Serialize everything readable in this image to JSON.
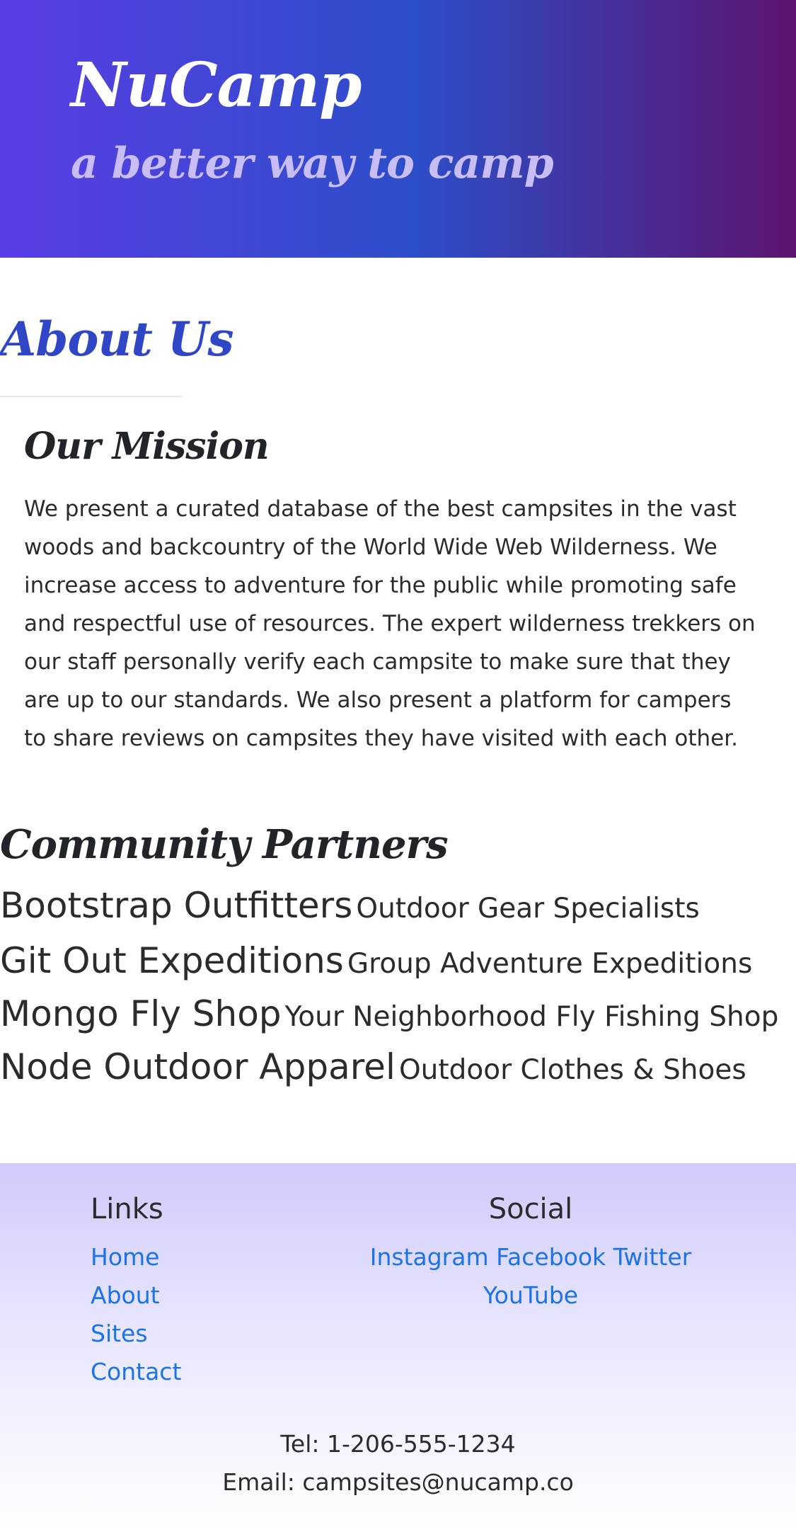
{
  "header": {
    "brand": "NuCamp",
    "tagline": "a better way to camp"
  },
  "about": {
    "title": "About Us",
    "mission_title": "Our Mission",
    "mission_text": "We present a curated database of the best campsites in the vast woods and backcountry of the World Wide Web Wilderness. We increase access to adventure for the public while promoting safe and respectful use of resources. The expert wilderness trekkers on our staff personally verify each campsite to make sure that they are up to our standards. We also present a platform for campers to share reviews on campsites they have visited with each other."
  },
  "partners": {
    "title": "Community Partners",
    "items": [
      {
        "name": "Bootstrap Outfitters",
        "desc": "Outdoor Gear Specialists"
      },
      {
        "name": "Git Out Expeditions",
        "desc": "Group Adventure Expeditions"
      },
      {
        "name": "Mongo Fly Shop",
        "desc": "Your Neighborhood Fly Fishing Shop"
      },
      {
        "name": "Node Outdoor Apparel",
        "desc": "Outdoor Clothes & Shoes"
      }
    ]
  },
  "footer": {
    "links_heading": "Links",
    "links": [
      "Home",
      "About",
      "Sites",
      "Contact"
    ],
    "social_heading": "Social",
    "social": [
      "Instagram",
      "Facebook",
      "Twitter",
      "YouTube"
    ],
    "tel": "Tel: 1-206-555-1234",
    "email": "Email: campsites@nucamp.co"
  },
  "colors": {
    "header_gradient_start": "#5a3de4",
    "header_gradient_mid": "#2c4ec9",
    "header_gradient_end": "#5d1470",
    "about_title": "#2f47c6",
    "link": "#1a73e8",
    "footer_top": "#cfcafc"
  }
}
